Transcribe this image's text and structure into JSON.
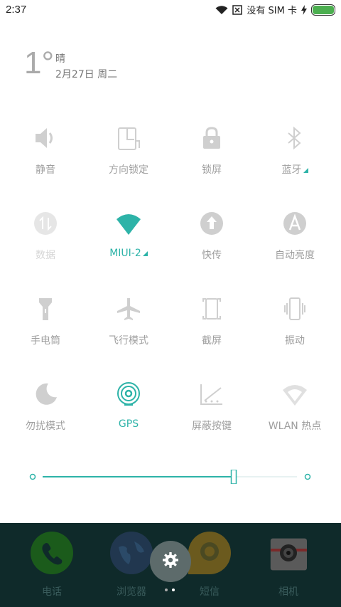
{
  "status": {
    "time": "2:37",
    "no_sim": "没有 SIM 卡",
    "battery_level": 1.0
  },
  "weather": {
    "temp": "1°",
    "desc": "晴",
    "date": "2月27日 周二"
  },
  "tiles": [
    {
      "label": "静音",
      "icon": "speaker-icon",
      "state": "off"
    },
    {
      "label": "方向锁定",
      "icon": "rotation-lock-icon",
      "state": "off"
    },
    {
      "label": "锁屏",
      "icon": "lock-icon",
      "state": "off"
    },
    {
      "label": "蓝牙",
      "icon": "bluetooth-icon",
      "state": "off",
      "expand": true
    },
    {
      "label": "数据",
      "icon": "mobile-data-icon",
      "state": "disabled"
    },
    {
      "label": "MIUI-2",
      "icon": "wifi-icon",
      "state": "active",
      "expand": true
    },
    {
      "label": "快传",
      "icon": "quick-transfer-icon",
      "state": "off"
    },
    {
      "label": "自动亮度",
      "icon": "auto-brightness-icon",
      "state": "off"
    },
    {
      "label": "手电筒",
      "icon": "flashlight-icon",
      "state": "off"
    },
    {
      "label": "飞行模式",
      "icon": "airplane-icon",
      "state": "off"
    },
    {
      "label": "截屏",
      "icon": "screenshot-icon",
      "state": "off"
    },
    {
      "label": "振动",
      "icon": "vibrate-icon",
      "state": "off"
    },
    {
      "label": "勿扰模式",
      "icon": "moon-icon",
      "state": "off"
    },
    {
      "label": "GPS",
      "icon": "gps-icon",
      "state": "active"
    },
    {
      "label": "屏蔽按键",
      "icon": "block-keys-icon",
      "state": "off"
    },
    {
      "label": "WLAN 热点",
      "icon": "hotspot-icon",
      "state": "off"
    }
  ],
  "brightness": {
    "level": 0.75
  },
  "dock": {
    "apps": [
      {
        "label": "电话",
        "icon": "phone-icon"
      },
      {
        "label": "浏览器",
        "icon": "browser-icon"
      },
      {
        "label": "短信",
        "icon": "messages-icon"
      },
      {
        "label": "相机",
        "icon": "camera-icon"
      }
    ],
    "settings_icon": "gear-icon",
    "page_count": 2,
    "current_page": 2
  },
  "colors": {
    "accent": "#2db3a8",
    "inactive": "#9e9e9e",
    "dock_bg": "#0f2a2a"
  }
}
